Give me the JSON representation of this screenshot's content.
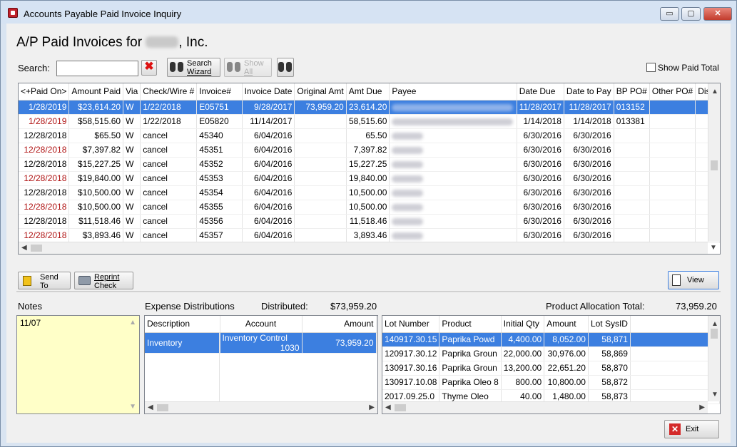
{
  "window": {
    "title": "Accounts Payable Paid Invoice Inquiry",
    "controls": {
      "minimize": "▭",
      "maximize": "▢",
      "close": "✕"
    }
  },
  "heading": {
    "prefix": "A/P Paid Invoices for ",
    "suffix": ", Inc."
  },
  "search": {
    "label": "Search:",
    "value": ""
  },
  "toolbar": {
    "search_wizard_line1": "Search",
    "search_wizard_line2": "Wizard",
    "show_all_line1": "Show",
    "show_all_line2": "All"
  },
  "show_paid_total": {
    "label": "Show Paid Total",
    "checked": false
  },
  "invoices": {
    "columns": [
      "<+Paid On>",
      "Amount Paid",
      "Via",
      "Check/Wire #",
      "Invoice#",
      "Invoice Date",
      "Original Amt",
      "Amt Due",
      "Payee",
      "Date Due",
      "Date to Pay",
      "BP PO#",
      "Other PO#",
      "Disc"
    ],
    "rows": [
      {
        "paid_on": "1/28/2019",
        "amount_paid": "$23,614.20",
        "via": "W",
        "check": "1/22/2018",
        "invoice": "E05751",
        "invoice_date": "9/28/2017",
        "original_amt": "73,959.20",
        "amt_due": "23,614.20",
        "date_due": "11/28/2017",
        "date_to_pay": "11/28/2017",
        "bp_po": "013152",
        "other_po": "",
        "red": true,
        "selected": true
      },
      {
        "paid_on": "1/28/2019",
        "amount_paid": "$58,515.60",
        "via": "W",
        "check": "1/22/2018",
        "invoice": "E05820",
        "invoice_date": "11/14/2017",
        "original_amt": "",
        "amt_due": "58,515.60",
        "date_due": "1/14/2018",
        "date_to_pay": "1/14/2018",
        "bp_po": "013381",
        "other_po": "",
        "red": true,
        "selected": false
      },
      {
        "paid_on": "12/28/2018",
        "amount_paid": "$65.50",
        "via": "W",
        "check": "cancel",
        "invoice": "45340",
        "invoice_date": "6/04/2016",
        "original_amt": "",
        "amt_due": "65.50",
        "date_due": "6/30/2016",
        "date_to_pay": "6/30/2016",
        "bp_po": "",
        "other_po": "",
        "red": false,
        "selected": false
      },
      {
        "paid_on": "12/28/2018",
        "amount_paid": "$7,397.82",
        "via": "W",
        "check": "cancel",
        "invoice": "45351",
        "invoice_date": "6/04/2016",
        "original_amt": "",
        "amt_due": "7,397.82",
        "date_due": "6/30/2016",
        "date_to_pay": "6/30/2016",
        "bp_po": "",
        "other_po": "",
        "red": true,
        "selected": false
      },
      {
        "paid_on": "12/28/2018",
        "amount_paid": "$15,227.25",
        "via": "W",
        "check": "cancel",
        "invoice": "45352",
        "invoice_date": "6/04/2016",
        "original_amt": "",
        "amt_due": "15,227.25",
        "date_due": "6/30/2016",
        "date_to_pay": "6/30/2016",
        "bp_po": "",
        "other_po": "",
        "red": false,
        "selected": false
      },
      {
        "paid_on": "12/28/2018",
        "amount_paid": "$19,840.00",
        "via": "W",
        "check": "cancel",
        "invoice": "45353",
        "invoice_date": "6/04/2016",
        "original_amt": "",
        "amt_due": "19,840.00",
        "date_due": "6/30/2016",
        "date_to_pay": "6/30/2016",
        "bp_po": "",
        "other_po": "",
        "red": true,
        "selected": false
      },
      {
        "paid_on": "12/28/2018",
        "amount_paid": "$10,500.00",
        "via": "W",
        "check": "cancel",
        "invoice": "45354",
        "invoice_date": "6/04/2016",
        "original_amt": "",
        "amt_due": "10,500.00",
        "date_due": "6/30/2016",
        "date_to_pay": "6/30/2016",
        "bp_po": "",
        "other_po": "",
        "red": false,
        "selected": false
      },
      {
        "paid_on": "12/28/2018",
        "amount_paid": "$10,500.00",
        "via": "W",
        "check": "cancel",
        "invoice": "45355",
        "invoice_date": "6/04/2016",
        "original_amt": "",
        "amt_due": "10,500.00",
        "date_due": "6/30/2016",
        "date_to_pay": "6/30/2016",
        "bp_po": "",
        "other_po": "",
        "red": true,
        "selected": false
      },
      {
        "paid_on": "12/28/2018",
        "amount_paid": "$11,518.46",
        "via": "W",
        "check": "cancel",
        "invoice": "45356",
        "invoice_date": "6/04/2016",
        "original_amt": "",
        "amt_due": "11,518.46",
        "date_due": "6/30/2016",
        "date_to_pay": "6/30/2016",
        "bp_po": "",
        "other_po": "",
        "red": false,
        "selected": false
      },
      {
        "paid_on": "12/28/2018",
        "amount_paid": "$3,893.46",
        "via": "W",
        "check": "cancel",
        "invoice": "45357",
        "invoice_date": "6/04/2016",
        "original_amt": "",
        "amt_due": "3,893.46",
        "date_due": "6/30/2016",
        "date_to_pay": "6/30/2016",
        "bp_po": "",
        "other_po": "",
        "red": true,
        "selected": false
      }
    ]
  },
  "actions": {
    "send_to_line1": "Send",
    "send_to_line2": "To",
    "reprint_line1": "Reprint",
    "reprint_line2": "Check",
    "view": "View",
    "exit": "Exit"
  },
  "notes": {
    "label": "Notes",
    "text": "11/07"
  },
  "expense": {
    "label": "Expense Distributions",
    "distributed_label": "Distributed:",
    "distributed_value": "$73,959.20",
    "columns": [
      "Description",
      "Account",
      "Amount"
    ],
    "rows": [
      {
        "description": "Inventory",
        "account_name": "Inventory Control",
        "account_no": "1030",
        "amount": "73,959.20",
        "selected": true
      }
    ]
  },
  "product": {
    "label": "Product Allocation Total:",
    "total": "73,959.20",
    "columns": [
      "Lot Number",
      "Product",
      "Initial Qty",
      "Amount",
      "Lot SysID"
    ],
    "rows": [
      {
        "lot": "140917.30.15",
        "product": "Paprika Powd",
        "qty": "4,400.00",
        "amount": "8,052.00",
        "sysid": "58,871",
        "selected": true
      },
      {
        "lot": "120917.30.12",
        "product": "Paprika Groun",
        "qty": "22,000.00",
        "amount": "30,976.00",
        "sysid": "58,869",
        "selected": false
      },
      {
        "lot": "130917.30.16",
        "product": "Paprika Groun",
        "qty": "13,200.00",
        "amount": "22,651.20",
        "sysid": "58,870",
        "selected": false
      },
      {
        "lot": "130917.10.08",
        "product": "Paprika Oleo 8",
        "qty": "800.00",
        "amount": "10,800.00",
        "sysid": "58,872",
        "selected": false
      },
      {
        "lot": "2017.09.25.0",
        "product": "Thyme Oleo",
        "qty": "40.00",
        "amount": "1,480.00",
        "sysid": "58,873",
        "selected": false
      }
    ]
  }
}
